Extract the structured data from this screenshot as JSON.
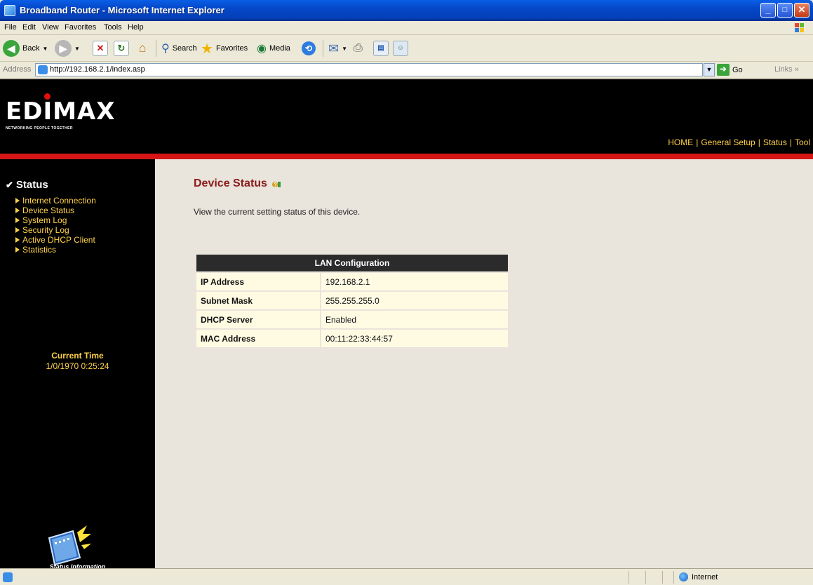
{
  "window": {
    "title": "Broadband Router - Microsoft Internet Explorer",
    "buttons": {
      "minimize": "_",
      "maximize": "□",
      "close": "✕"
    }
  },
  "menu": [
    "File",
    "Edit",
    "View",
    "Favorites",
    "Tools",
    "Help"
  ],
  "toolbar": {
    "back": "Back",
    "search": "Search",
    "favorites": "Favorites",
    "media": "Media"
  },
  "address": {
    "label": "Address",
    "url": "http://192.168.2.1/index.asp",
    "go": "Go",
    "links": "Links »"
  },
  "header": {
    "logo": "EDIMAX",
    "tagline": "NETWORKING PEOPLE TOGETHER",
    "nav": [
      "HOME",
      "General Setup",
      "Status",
      "Tool"
    ]
  },
  "sidebar": {
    "title": "Status",
    "items": [
      "Internet Connection",
      "Device Status",
      "System Log",
      "Security Log",
      "Active DHCP Client",
      "Statistics"
    ],
    "time_label": "Current Time",
    "time_value": "1/0/1970 0:25:24",
    "image_caption": "Status Information"
  },
  "content": {
    "title": "Device Status",
    "description": "View the current setting status of this device.",
    "table": {
      "header": "LAN Configuration",
      "rows": [
        {
          "key": "IP Address",
          "value": "192.168.2.1"
        },
        {
          "key": "Subnet Mask",
          "value": "255.255.255.0"
        },
        {
          "key": "DHCP Server",
          "value": "Enabled"
        },
        {
          "key": "MAC Address",
          "value": "00:11:22:33:44:57"
        }
      ]
    }
  },
  "statusbar": {
    "zone": "Internet"
  },
  "colors": {
    "accent_red": "#d61616",
    "nav_yellow": "#ffd24a",
    "title_red": "#8b1a1a",
    "cell_bg": "#fffbe3"
  }
}
